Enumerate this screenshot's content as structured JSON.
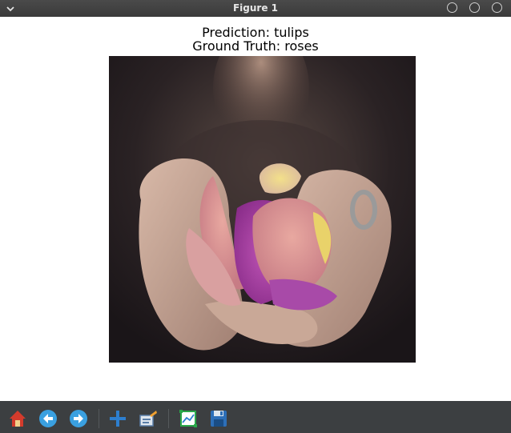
{
  "window": {
    "title": "Figure 1",
    "menu_icon": "chevron-down-icon",
    "controls": [
      "minimize-icon",
      "maximize-icon",
      "close-icon"
    ]
  },
  "figure": {
    "title_line1": "Prediction: tulips",
    "title_line2": "Ground Truth: roses",
    "image_subject": "hands holding rose petals"
  },
  "toolbar": {
    "buttons": [
      {
        "icon": "home-icon"
      },
      {
        "icon": "back-arrow-icon"
      },
      {
        "icon": "forward-arrow-icon"
      },
      {
        "icon": "pan-icon"
      },
      {
        "icon": "zoom-rect-icon"
      },
      {
        "icon": "subplots-icon"
      },
      {
        "icon": "save-icon"
      }
    ]
  },
  "colors": {
    "titlebar_bg": "#3f3f3f",
    "toolbar_bg": "#3c3f41",
    "canvas_bg": "#ffffff",
    "title_text": "#000000"
  }
}
